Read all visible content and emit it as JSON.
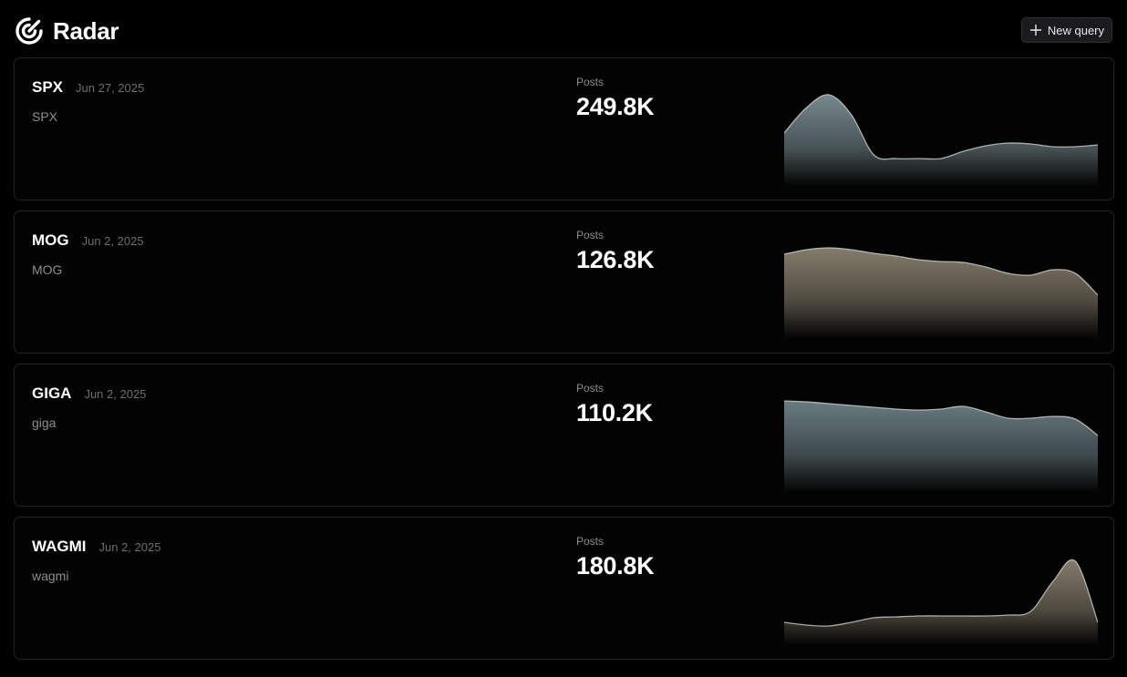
{
  "app": {
    "title": "Radar",
    "logo_icon": "radar-target-icon",
    "new_query_label": "New query",
    "new_query_icon": "plus-icon"
  },
  "cards": [
    {
      "name": "SPX",
      "date": "Jun 27, 2025",
      "query": "SPX",
      "metric_label": "Posts",
      "metric_value": "249.8K",
      "trend_color": "#7d9096",
      "trend": [
        0.58,
        0.86,
        1.0,
        0.78,
        0.34,
        0.3,
        0.3,
        0.3,
        0.38,
        0.44,
        0.47,
        0.46,
        0.43,
        0.43,
        0.45
      ]
    },
    {
      "name": "MOG",
      "date": "Jun 2, 2025",
      "query": "MOG",
      "metric_label": "Posts",
      "metric_value": "126.8K",
      "trend_color": "#8b8271",
      "trend": [
        0.93,
        0.98,
        1.0,
        0.98,
        0.94,
        0.91,
        0.87,
        0.85,
        0.84,
        0.79,
        0.72,
        0.7,
        0.76,
        0.72,
        0.48
      ]
    },
    {
      "name": "GIGA",
      "date": "Jun 2, 2025",
      "query": "giga",
      "metric_label": "Posts",
      "metric_value": "110.2K",
      "trend_color": "#6e8288",
      "trend": [
        1.0,
        0.99,
        0.97,
        0.95,
        0.93,
        0.91,
        0.9,
        0.91,
        0.94,
        0.88,
        0.81,
        0.81,
        0.83,
        0.8,
        0.62
      ]
    },
    {
      "name": "WAGMI",
      "date": "Jun 2, 2025",
      "query": "wagmi",
      "metric_label": "Posts",
      "metric_value": "180.8K",
      "trend_color": "#8b8271",
      "trend": [
        0.25,
        0.22,
        0.21,
        0.25,
        0.3,
        0.31,
        0.32,
        0.32,
        0.32,
        0.32,
        0.33,
        0.37,
        0.7,
        0.92,
        0.25
      ]
    }
  ]
}
